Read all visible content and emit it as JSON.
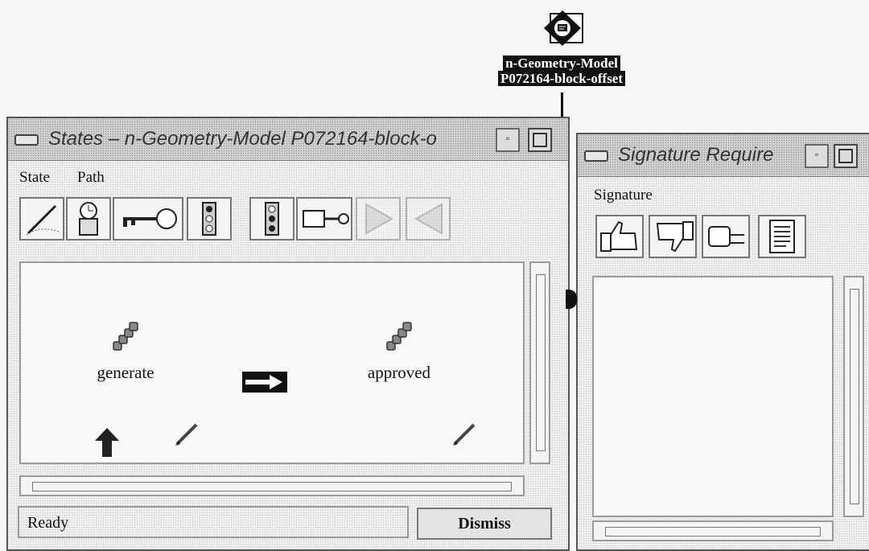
{
  "object_icon": {
    "label_line1": "n-Geometry-Model",
    "label_line2": "P072164-block-offset"
  },
  "states_window": {
    "title": "States – n-Geometry-Model P072164-block-o",
    "menu": [
      "State",
      "Path"
    ],
    "toolbar": [
      {
        "icon": "pen-icon",
        "enabled": true
      },
      {
        "icon": "clock-icon",
        "enabled": true
      },
      {
        "icon": "key-icon",
        "enabled": true
      },
      {
        "icon": "traffic-light-icon",
        "enabled": true
      },
      {
        "icon": "traffic-light-red-icon",
        "enabled": true
      },
      {
        "icon": "key-lock-icon",
        "enabled": true
      },
      {
        "icon": "forward-icon",
        "enabled": false
      },
      {
        "icon": "backward-icon",
        "enabled": false
      }
    ],
    "states": [
      {
        "name": "generate"
      },
      {
        "name": "approved"
      }
    ],
    "status": "Ready",
    "dismiss_label": "Dismiss"
  },
  "signature_window": {
    "title": "Signature Require",
    "menu": [
      "Signature"
    ],
    "toolbar": [
      {
        "icon": "thumbs-up-icon"
      },
      {
        "icon": "thumbs-down-icon"
      },
      {
        "icon": "fist-icon"
      },
      {
        "icon": "document-icon"
      }
    ]
  }
}
